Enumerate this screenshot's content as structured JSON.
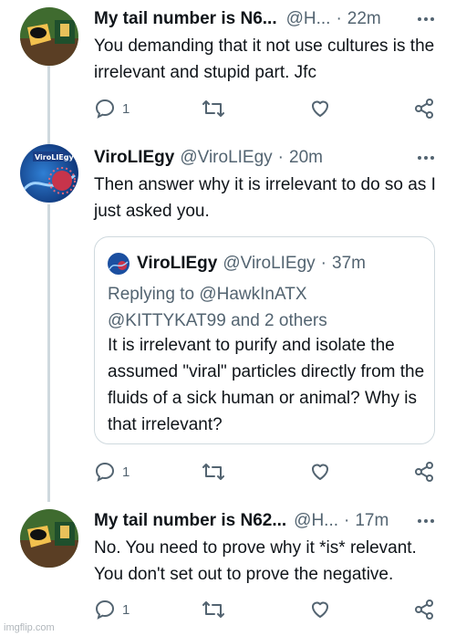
{
  "tweets": [
    {
      "name": "My tail number is N6...",
      "handle": "@H...",
      "dot": "·",
      "time": "22m",
      "text": "You demanding that it not use cultures is the irrelevant and stupid part. Jfc",
      "reply_count": "1"
    },
    {
      "name": "ViroLIEgy",
      "handle": "@ViroLIEgy",
      "dot": "·",
      "time": "20m",
      "text": "Then answer why it is irrelevant to do so as I just asked you.",
      "avatar_label": "ViroLIEgy",
      "reply_count": "1",
      "quote": {
        "name": "ViroLIEgy",
        "handle": "@ViroLIEgy",
        "dot": "·",
        "time": "37m",
        "replying_line1": "Replying to @HawkInATX",
        "replying_line2": "@KITTYKAT99 and 2 others",
        "text": "It is irrelevant to purify and isolate the assumed \"viral\" particles directly from the fluids of a sick human or animal? Why is that irrelevant?"
      }
    },
    {
      "name": "My tail number is N62...",
      "handle": "@H...",
      "dot": "·",
      "time": "17m",
      "text": "No. You need to prove why it *is* relevant. You don't set out to prove the negative.",
      "reply_count": "1"
    }
  ],
  "watermark": "imgflip.com",
  "colors": {
    "text": "#0f1419",
    "secondary": "#536471",
    "border": "#cfd9de",
    "thread": "#cfd9de"
  }
}
